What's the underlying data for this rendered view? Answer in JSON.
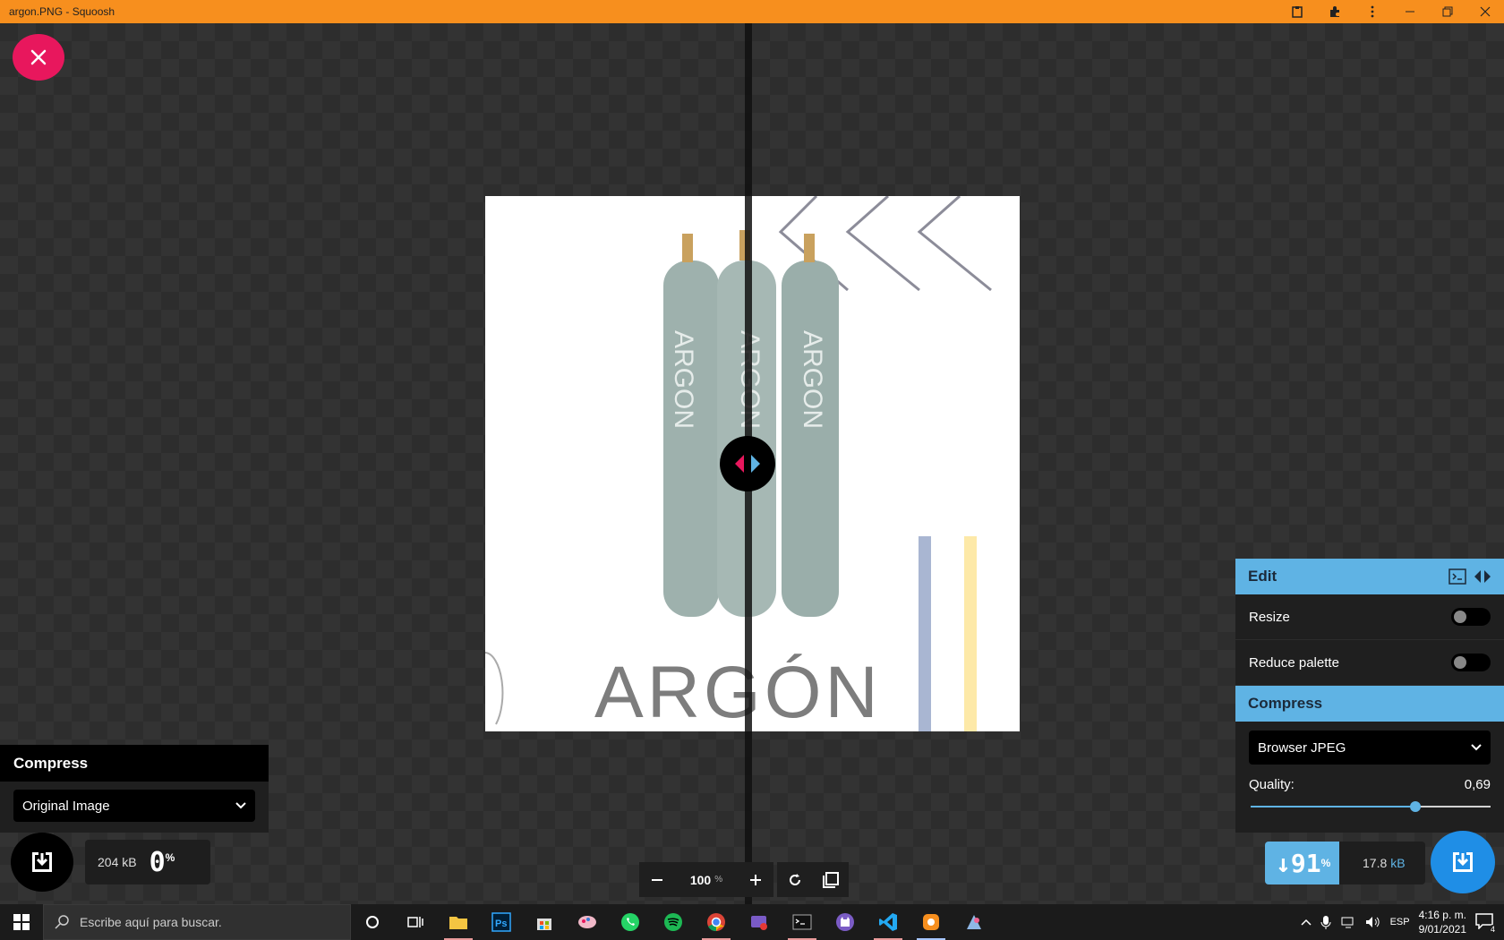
{
  "window": {
    "title": "argon.PNG - Squoosh"
  },
  "left_panel": {
    "title": "Compress",
    "select_value": "Original Image",
    "size_value": "204",
    "size_unit": "kB",
    "percent": "0",
    "percent_unit": "%"
  },
  "image": {
    "main_text": "ARGÓN",
    "cylinder_text": "ARGON"
  },
  "zoom": {
    "value": "100",
    "unit": "%"
  },
  "right_panel": {
    "edit_title": "Edit",
    "resize_label": "Resize",
    "reduce_palette_label": "Reduce palette",
    "compress_title": "Compress",
    "codec_value": "Browser JPEG",
    "quality_label": "Quality:",
    "quality_value": "0,69",
    "quality_fraction": 0.69
  },
  "result": {
    "arrow": "↓",
    "percent": "91",
    "percent_unit": "%",
    "size_value": "17.8",
    "size_unit": "kB"
  },
  "taskbar": {
    "search_placeholder": "Escribe aquí para buscar.",
    "language": "ESP",
    "time": "4:16 p. m.",
    "date": "9/01/2021",
    "notifications": "4"
  },
  "colors": {
    "titlebar": "#f78f1e",
    "accent_blue": "#5fb3e4",
    "close_pink": "#e8175d"
  }
}
